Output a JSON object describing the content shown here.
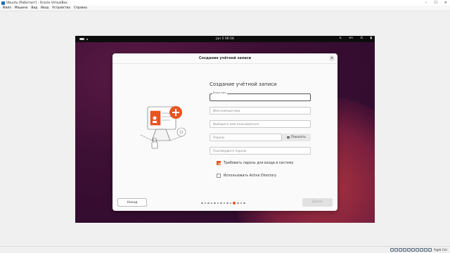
{
  "window": {
    "title": "Ubuntu [Работает] - Oracle VirtualBox",
    "controls": [
      "–",
      "☐",
      "✕"
    ]
  },
  "menu": [
    "Файл",
    "Машина",
    "Вид",
    "Ввод",
    "Устройства",
    "Справка"
  ],
  "gnome": {
    "clock": "Jan 5  06:56",
    "keyboard": "en"
  },
  "dialog": {
    "title": "Создание учётной записи",
    "heading": "Создание учётной записи",
    "name_label": "Ваше имя",
    "computer_placeholder": "Имя компьютера",
    "username_placeholder": "Выберите имя пользователя",
    "password_placeholder": "Пароль",
    "show_label": "Показать",
    "confirm_placeholder": "Подтвердите пароль",
    "require_password_label": "Требовать пароль для входа в систему",
    "require_password_checked": true,
    "ad_label": "Использовать Active Directory",
    "ad_checked": false,
    "back_label": "Назад",
    "next_label": "Далее",
    "progress": {
      "total": 14,
      "current": 10
    }
  },
  "statusbar": {
    "hostkey": "Right Ctrl"
  },
  "colors": {
    "accent": "#e95420",
    "dialog_bg": "#fafafa",
    "guest_bg": "#3d0f34"
  }
}
